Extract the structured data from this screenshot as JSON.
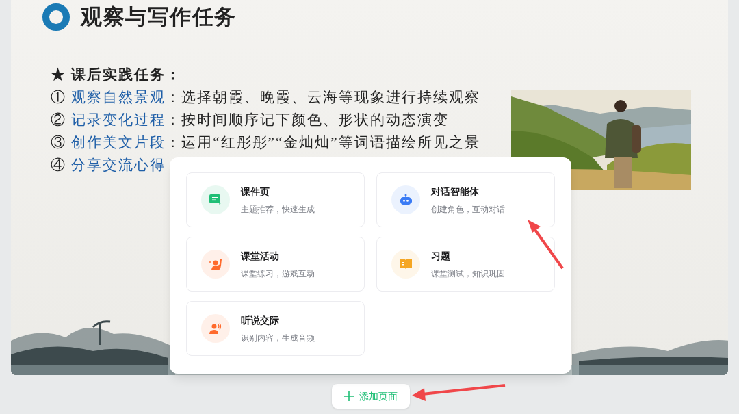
{
  "slide": {
    "title": "观察与写作任务",
    "task_heading": "★ 课后实践任务：",
    "tasks": [
      {
        "marker": "①",
        "name": "观察自然景观",
        "text": "：选择朝霞、晚霞、云海等现象进行持续观察"
      },
      {
        "marker": "②",
        "name": "记录变化过程",
        "text": "：按时间顺序记下颜色、形状的动态演变"
      },
      {
        "marker": "③",
        "name": "创作美文片段",
        "text": "：运用“红彤彤”“金灿灿”等词语描绘所见之景"
      },
      {
        "marker": "④",
        "name": "分享交流心得"
      }
    ]
  },
  "menu": {
    "items": [
      {
        "kind": "courseware",
        "title": "课件页",
        "subtitle": "主题推荐，快速生成",
        "color": "#1fbf76"
      },
      {
        "kind": "agent",
        "title": "对话智能体",
        "subtitle": "创建角色，互动对话",
        "color": "#3a7bf5"
      },
      {
        "kind": "activity",
        "title": "课堂活动",
        "subtitle": "课堂练习，游戏互动",
        "color": "#ff6a2c"
      },
      {
        "kind": "exercise",
        "title": "习题",
        "subtitle": "课堂测试，知识巩固",
        "color": "#f5a623"
      },
      {
        "kind": "speaking",
        "title": "听说交际",
        "subtitle": "识别内容，生成音频",
        "color": "#ff6a2c"
      }
    ]
  },
  "add_page_button": {
    "label": "添加页面"
  }
}
